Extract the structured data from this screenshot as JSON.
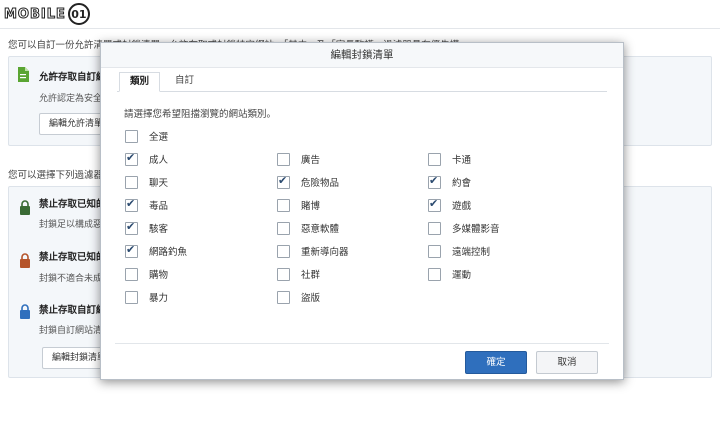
{
  "logo": {
    "text": "MOBILE",
    "mark": "01"
  },
  "background": {
    "intro_text": "您可以自訂一份允許清單或封鎖清單，允許存取或封鎖特定網站。「其中」及「家長監護」過濾器具有優先權。",
    "allow_card": {
      "title": "允許存取自訂網站",
      "desc": "允許認定為安全的網站",
      "button": "編輯允許清單"
    },
    "filter_intro": "您可以選擇下列過濾器",
    "filters": [
      {
        "title": "禁止存取已知的惡意網站",
        "desc": "封鎖足以構成惡意的網站",
        "color": "#3a6b35"
      },
      {
        "title": "禁止存取已知的成人網站",
        "desc": "封鎖不適合未成年人的網站",
        "color": "#b5542a"
      },
      {
        "title": "禁止存取自訂網站",
        "desc": "封鎖自訂網站清單中的網站",
        "color": "#2f6fbd"
      }
    ],
    "block_button": "編輯封鎖清單"
  },
  "modal": {
    "title": "編輯封鎖清單",
    "tabs": [
      {
        "label": "類別",
        "active": true
      },
      {
        "label": "自訂",
        "active": false
      }
    ],
    "instruction": "請選擇您希望阻擋瀏覽的網站類別。",
    "select_all": {
      "label": "全選",
      "checked": false
    },
    "options": [
      {
        "label": "成人",
        "checked": true
      },
      {
        "label": "廣告",
        "checked": false
      },
      {
        "label": "卡通",
        "checked": false
      },
      {
        "label": "聊天",
        "checked": false
      },
      {
        "label": "危險物品",
        "checked": true
      },
      {
        "label": "約會",
        "checked": true
      },
      {
        "label": "毒品",
        "checked": true
      },
      {
        "label": "賭博",
        "checked": false
      },
      {
        "label": "遊戲",
        "checked": true
      },
      {
        "label": "駭客",
        "checked": true
      },
      {
        "label": "惡意軟體",
        "checked": false
      },
      {
        "label": "多媒體影音",
        "checked": false
      },
      {
        "label": "網路釣魚",
        "checked": true
      },
      {
        "label": "重新導向器",
        "checked": false
      },
      {
        "label": "遠端控制",
        "checked": false
      },
      {
        "label": "購物",
        "checked": false
      },
      {
        "label": "社群",
        "checked": false
      },
      {
        "label": "運動",
        "checked": false
      },
      {
        "label": "暴力",
        "checked": false
      },
      {
        "label": "盜版",
        "checked": false
      }
    ],
    "ok_label": "確定",
    "cancel_label": "取消"
  }
}
